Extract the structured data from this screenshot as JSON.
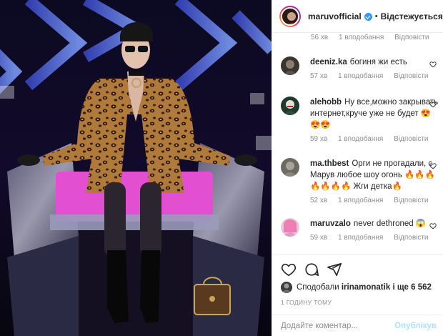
{
  "post": {
    "owner": "maruvofficial",
    "separator": "•",
    "follow_label": "Відстежується",
    "cut_meta": {
      "time": "56 хв",
      "likes": "1 вподобання",
      "reply": "Відповісти"
    }
  },
  "comments": [
    {
      "user": "deeniz.ka",
      "text": "богиня жи есть",
      "time": "57 хв",
      "likes": "1 вподобання",
      "reply": "Відповісти"
    },
    {
      "user": "alehobb",
      "text": "Ну все,можно закрывать интернет,круче уже не будет 😍😍😍",
      "time": "59 хв",
      "likes": "1 вподобання",
      "reply": "Відповісти"
    },
    {
      "user": "ma.thbest",
      "text": "Орги не прогадали, с Марув любое шоу огонь 🔥🔥🔥🔥🔥🔥🔥 Жги детка🔥",
      "time": "52 хв",
      "likes": "1 вподобання",
      "reply": "Відповісти"
    },
    {
      "user": "maruvzalo",
      "text": "never dethroned 😱",
      "time": "59 хв",
      "likes": "1 вподобання",
      "reply": "Відповісти"
    }
  ],
  "likes": {
    "prefix": "Сподобали",
    "user": "irinamonatik",
    "rest": "і ще 6 562"
  },
  "timestamp": "1 ГОДИНУ ТОМУ",
  "add_comment": {
    "placeholder": "Додайте коментар...",
    "publish_label": "Опублікув"
  },
  "icons": [
    "verified-icon",
    "heart-icon",
    "comment-icon",
    "share-icon",
    "small-heart-icon"
  ],
  "colors": {
    "verified": "#3897f0",
    "link": "#b2dffc",
    "meta": "#8e8e8e",
    "text": "#262626"
  }
}
